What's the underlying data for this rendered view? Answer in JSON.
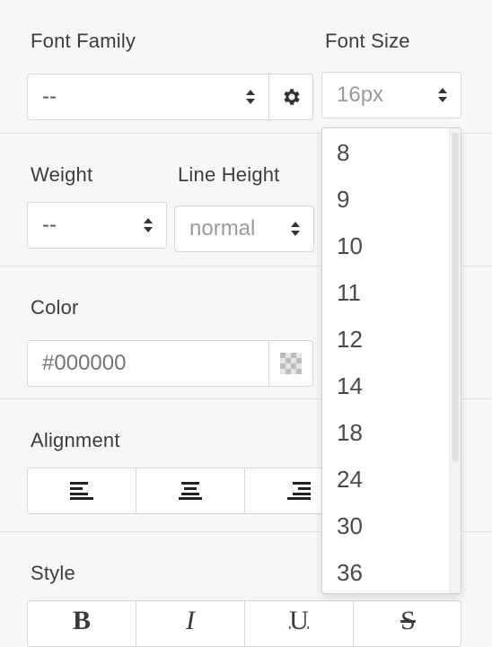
{
  "font_family": {
    "label": "Font Family",
    "value": "--",
    "settings_icon": "gear-icon"
  },
  "font_size": {
    "label": "Font Size",
    "value": "16px",
    "options": [
      "8",
      "9",
      "10",
      "11",
      "12",
      "14",
      "18",
      "24",
      "30",
      "36"
    ]
  },
  "weight": {
    "label": "Weight",
    "value": "--"
  },
  "line_height": {
    "label": "Line Height",
    "value": "normal"
  },
  "color": {
    "label": "Color",
    "placeholder": "#000000",
    "swatch_icon": "checkerboard-swatch-icon"
  },
  "alignment": {
    "label": "Alignment",
    "options": [
      "align-left-icon",
      "align-center-icon",
      "align-right-icon"
    ]
  },
  "style": {
    "label": "Style",
    "options": [
      "B",
      "I",
      "U",
      "S"
    ]
  },
  "colors": {
    "background": "#f7f7f7",
    "border": "#d6d6d6",
    "text": "#3d3d3d",
    "muted": "#9a9a9a"
  }
}
